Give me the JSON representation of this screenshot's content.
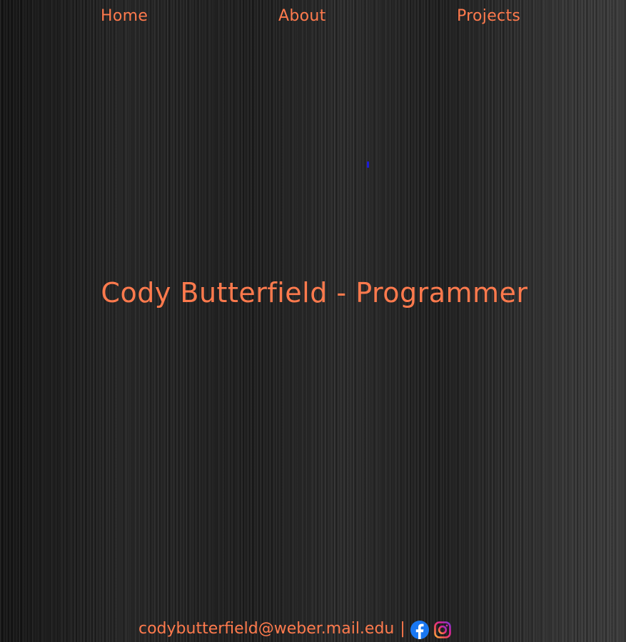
{
  "nav": {
    "items": [
      {
        "label": "Home"
      },
      {
        "label": "About"
      },
      {
        "label": "Projects"
      }
    ]
  },
  "hero": {
    "title": "Cody Butterfield - Programmer"
  },
  "footer": {
    "email": "codybutterfield@weber.mail.edu",
    "separator": "|",
    "social": [
      {
        "icon": "facebook-icon",
        "color": "#1877f2"
      },
      {
        "icon": "instagram-icon",
        "color": "#d6249f"
      }
    ]
  },
  "colors": {
    "accent": "#ff7a4d",
    "background": "#1b1b1b"
  }
}
